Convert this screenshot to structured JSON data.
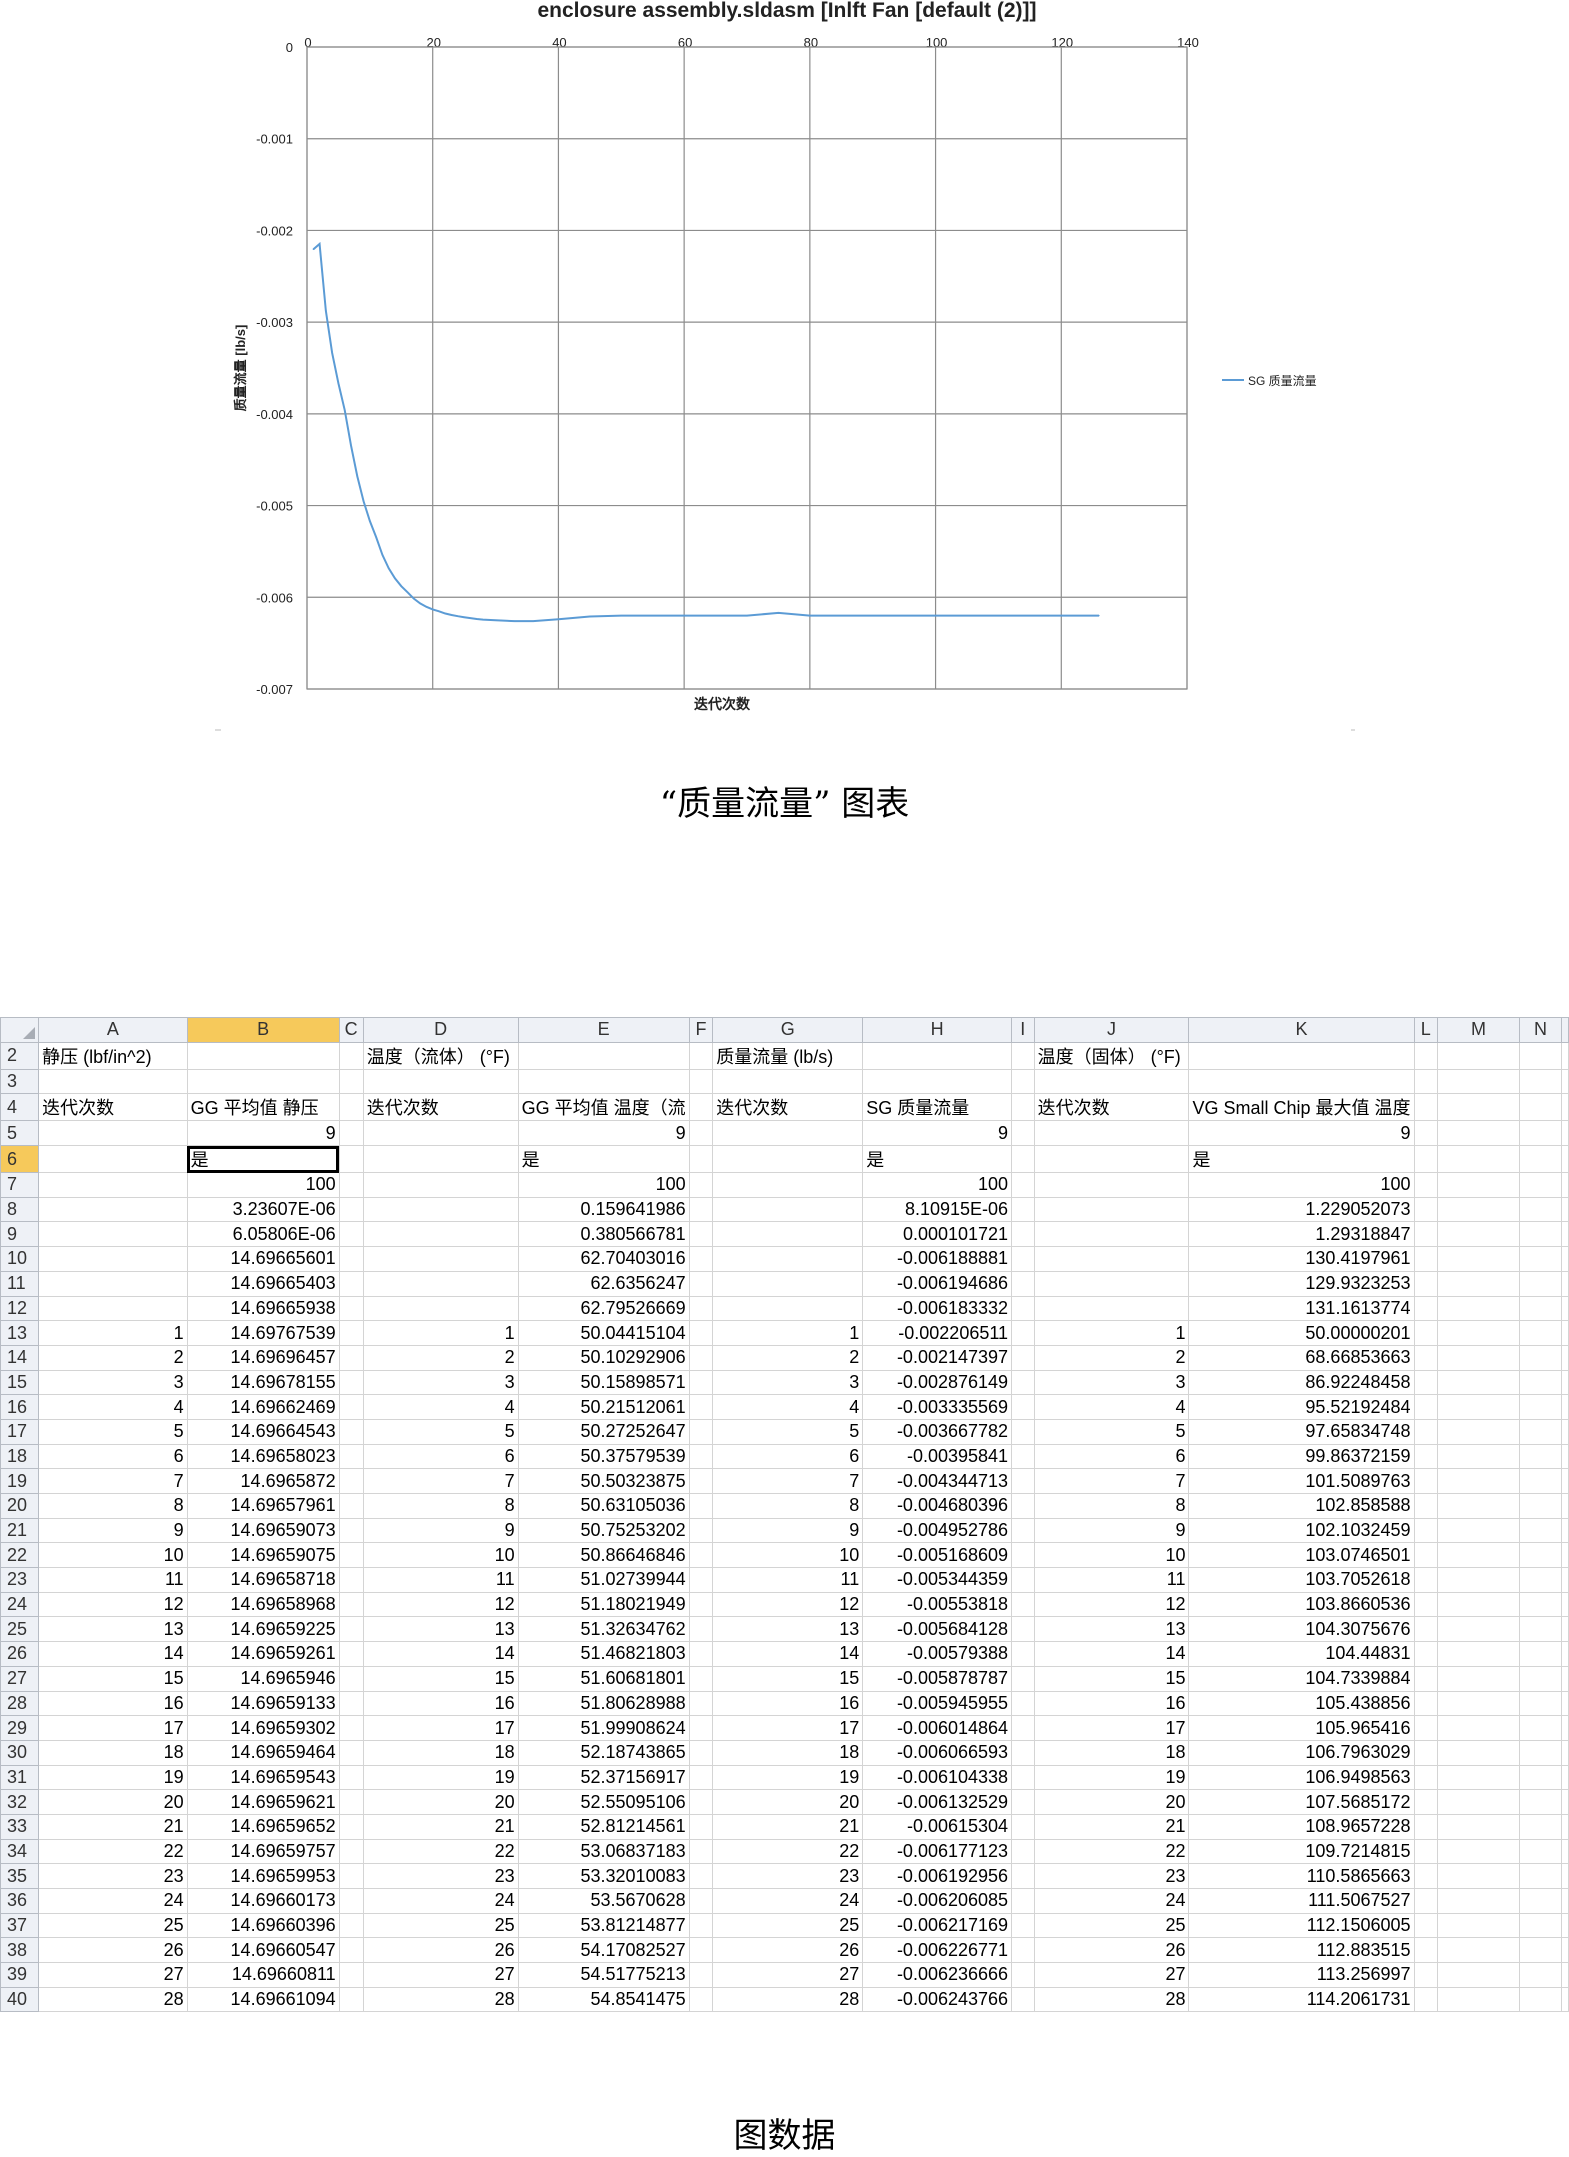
{
  "chart_data": {
    "type": "line",
    "title": "enclosure assembly.sldasm  [Inlft Fan [default (2)]]",
    "xlabel": "迭代次数",
    "ylabel": "质量流量 [lb/s]",
    "xlim": [
      0,
      140
    ],
    "ylim": [
      -0.007,
      0
    ],
    "xticks": [
      "0",
      "20",
      "40",
      "60",
      "80",
      "100",
      "120",
      "140"
    ],
    "yticks": [
      "0",
      "-0.001",
      "-0.002",
      "-0.003",
      "-0.004",
      "-0.005",
      "-0.006",
      "-0.007"
    ],
    "grid": true,
    "legend_position": "right",
    "series": [
      {
        "name": "SG 质量流量",
        "color": "#5b9bd5",
        "x": [
          1,
          2,
          3,
          4,
          5,
          6,
          7,
          8,
          9,
          10,
          11,
          12,
          13,
          14,
          15,
          16,
          17,
          18,
          19,
          20,
          21,
          22,
          23,
          24,
          25,
          26,
          27,
          28,
          30,
          33,
          36,
          40,
          45,
          50,
          60,
          70,
          75,
          80,
          90,
          100,
          110,
          120,
          126
        ],
        "y": [
          -0.002206511,
          -0.002147397,
          -0.002876149,
          -0.003335569,
          -0.003667782,
          -0.00395841,
          -0.004344713,
          -0.004680396,
          -0.004952786,
          -0.005168609,
          -0.005344359,
          -0.00553818,
          -0.005684128,
          -0.00579388,
          -0.005878787,
          -0.005945955,
          -0.006014864,
          -0.006066593,
          -0.006104338,
          -0.006132529,
          -0.00615304,
          -0.006177123,
          -0.006192956,
          -0.006206085,
          -0.006217169,
          -0.006226771,
          -0.006236666,
          -0.006243766,
          -0.00625,
          -0.00626,
          -0.00626,
          -0.00624,
          -0.00621,
          -0.0062,
          -0.0062,
          -0.0062,
          -0.00617,
          -0.0062,
          -0.0062,
          -0.0062,
          -0.0062,
          -0.0062,
          -0.0062
        ]
      }
    ]
  },
  "captions": {
    "chart_caption": "“质量流量”  图表",
    "table_caption": "图数据"
  },
  "sheet": {
    "columns": [
      "A",
      "B",
      "C",
      "D",
      "E",
      "F",
      "G",
      "H",
      "I",
      "J",
      "K",
      "L",
      "M",
      "N"
    ],
    "selected_column": "B",
    "selected_row": "6",
    "header_rows": [
      {
        "row": "2",
        "A": "静压 (lbf/in^2)",
        "D": "温度（流体） (°F)",
        "G": "质量流量 (lb/s)",
        "J": "温度（固体） (°F)"
      },
      {
        "row": "3"
      },
      {
        "row": "4",
        "A": "迭代次数",
        "B": "GG 平均值 静压",
        "D": "迭代次数",
        "E": "GG 平均值 温度（流",
        "G": "迭代次数",
        "H": "SG 质量流量",
        "J": "迭代次数",
        "K": "VG Small Chip 最大值 温度"
      },
      {
        "row": "5",
        "B": "9",
        "E": "9",
        "H": "9",
        "K": "9"
      },
      {
        "row": "6",
        "B": "是",
        "E": "是",
        "H": "是",
        "K": "是"
      },
      {
        "row": "7",
        "B": "100",
        "E": "100",
        "H": "100",
        "K": "100"
      },
      {
        "row": "8",
        "B": "3.23607E-06",
        "E": "0.159641986",
        "H": "8.10915E-06",
        "K": "1.229052073"
      },
      {
        "row": "9",
        "B": "6.05806E-06",
        "E": "0.380566781",
        "H": "0.000101721",
        "K": "1.29318847"
      },
      {
        "row": "10",
        "B": "14.69665601",
        "E": "62.70403016",
        "H": "-0.006188881",
        "K": "130.4197961"
      },
      {
        "row": "11",
        "B": "14.69665403",
        "E": "62.6356247",
        "H": "-0.006194686",
        "K": "129.9323253"
      },
      {
        "row": "12",
        "B": "14.69665938",
        "E": "62.79526669",
        "H": "-0.006183332",
        "K": "131.1613774"
      }
    ],
    "data_rows": [
      {
        "row": "13",
        "it": "1",
        "B": "14.69767539",
        "E": "50.04415104",
        "H": "-0.002206511",
        "K": "50.00000201"
      },
      {
        "row": "14",
        "it": "2",
        "B": "14.69696457",
        "E": "50.10292906",
        "H": "-0.002147397",
        "K": "68.66853663"
      },
      {
        "row": "15",
        "it": "3",
        "B": "14.69678155",
        "E": "50.15898571",
        "H": "-0.002876149",
        "K": "86.92248458"
      },
      {
        "row": "16",
        "it": "4",
        "B": "14.69662469",
        "E": "50.21512061",
        "H": "-0.003335569",
        "K": "95.52192484"
      },
      {
        "row": "17",
        "it": "5",
        "B": "14.69664543",
        "E": "50.27252647",
        "H": "-0.003667782",
        "K": "97.65834748"
      },
      {
        "row": "18",
        "it": "6",
        "B": "14.69658023",
        "E": "50.37579539",
        "H": "-0.00395841",
        "K": "99.86372159"
      },
      {
        "row": "19",
        "it": "7",
        "B": "14.6965872",
        "E": "50.50323875",
        "H": "-0.004344713",
        "K": "101.5089763"
      },
      {
        "row": "20",
        "it": "8",
        "B": "14.69657961",
        "E": "50.63105036",
        "H": "-0.004680396",
        "K": "102.858588"
      },
      {
        "row": "21",
        "it": "9",
        "B": "14.69659073",
        "E": "50.75253202",
        "H": "-0.004952786",
        "K": "102.1032459"
      },
      {
        "row": "22",
        "it": "10",
        "B": "14.69659075",
        "E": "50.86646846",
        "H": "-0.005168609",
        "K": "103.0746501"
      },
      {
        "row": "23",
        "it": "11",
        "B": "14.69658718",
        "E": "51.02739944",
        "H": "-0.005344359",
        "K": "103.7052618"
      },
      {
        "row": "24",
        "it": "12",
        "B": "14.69658968",
        "E": "51.18021949",
        "H": "-0.00553818",
        "K": "103.8660536"
      },
      {
        "row": "25",
        "it": "13",
        "B": "14.69659225",
        "E": "51.32634762",
        "H": "-0.005684128",
        "K": "104.3075676"
      },
      {
        "row": "26",
        "it": "14",
        "B": "14.69659261",
        "E": "51.46821803",
        "H": "-0.00579388",
        "K": "104.44831"
      },
      {
        "row": "27",
        "it": "15",
        "B": "14.6965946",
        "E": "51.60681801",
        "H": "-0.005878787",
        "K": "104.7339884"
      },
      {
        "row": "28",
        "it": "16",
        "B": "14.69659133",
        "E": "51.80628988",
        "H": "-0.005945955",
        "K": "105.438856"
      },
      {
        "row": "29",
        "it": "17",
        "B": "14.69659302",
        "E": "51.99908624",
        "H": "-0.006014864",
        "K": "105.965416"
      },
      {
        "row": "30",
        "it": "18",
        "B": "14.69659464",
        "E": "52.18743865",
        "H": "-0.006066593",
        "K": "106.7963029"
      },
      {
        "row": "31",
        "it": "19",
        "B": "14.69659543",
        "E": "52.37156917",
        "H": "-0.006104338",
        "K": "106.9498563"
      },
      {
        "row": "32",
        "it": "20",
        "B": "14.69659621",
        "E": "52.55095106",
        "H": "-0.006132529",
        "K": "107.5685172"
      },
      {
        "row": "33",
        "it": "21",
        "B": "14.69659652",
        "E": "52.81214561",
        "H": "-0.00615304",
        "K": "108.9657228"
      },
      {
        "row": "34",
        "it": "22",
        "B": "14.69659757",
        "E": "53.06837183",
        "H": "-0.006177123",
        "K": "109.7214815"
      },
      {
        "row": "35",
        "it": "23",
        "B": "14.69659953",
        "E": "53.32010083",
        "H": "-0.006192956",
        "K": "110.5865663"
      },
      {
        "row": "36",
        "it": "24",
        "B": "14.69660173",
        "E": "53.5670628",
        "H": "-0.006206085",
        "K": "111.5067527"
      },
      {
        "row": "37",
        "it": "25",
        "B": "14.69660396",
        "E": "53.81214877",
        "H": "-0.006217169",
        "K": "112.1506005"
      },
      {
        "row": "38",
        "it": "26",
        "B": "14.69660547",
        "E": "54.17082527",
        "H": "-0.006226771",
        "K": "112.883515"
      },
      {
        "row": "39",
        "it": "27",
        "B": "14.69660811",
        "E": "54.51775213",
        "H": "-0.006236666",
        "K": "113.256997"
      },
      {
        "row": "40",
        "it": "28",
        "B": "14.69661094",
        "E": "54.8541475",
        "H": "-0.006243766",
        "K": "114.2061731"
      }
    ]
  }
}
